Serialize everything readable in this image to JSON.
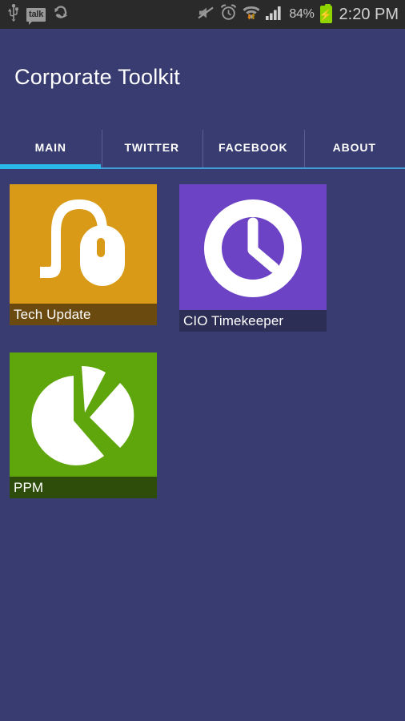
{
  "statusbar": {
    "left_icons": [
      {
        "name": "usb-icon",
        "glyph": "usb"
      },
      {
        "name": "talk-icon",
        "label": "talk"
      },
      {
        "name": "sync-icon",
        "glyph": "sync"
      }
    ],
    "right_icons": [
      {
        "name": "mute-icon",
        "glyph": "speaker-muted"
      },
      {
        "name": "alarm-clock-icon",
        "glyph": "alarm"
      },
      {
        "name": "wifi-data-icon",
        "glyph": "wifi-download"
      },
      {
        "name": "signal-bars-icon",
        "glyph": "signal"
      }
    ],
    "battery_percent": "84%",
    "battery_charging": true,
    "time": "2:20 PM"
  },
  "header": {
    "title": "Corporate Toolkit"
  },
  "tabs": {
    "items": [
      {
        "label": "MAIN",
        "active": true
      },
      {
        "label": "TWITTER",
        "active": false
      },
      {
        "label": "FACEBOOK",
        "active": false
      },
      {
        "label": "ABOUT",
        "active": false
      }
    ],
    "indicator_color": "#2bb8e8",
    "underline_color": "#3f9fd6"
  },
  "colors": {
    "background": "#383c70",
    "statusbar": "#2a2a2a",
    "accent": "#2bb8e8",
    "battery_green": "#8fd400"
  },
  "tiles": [
    {
      "label": "Tech Update",
      "icon": "mouse-icon",
      "tile_color": "#d99a17",
      "label_bar_color": "#6b4a10",
      "label_text_color": "#ffffff"
    },
    {
      "label": "CIO Timekeeper",
      "icon": "clock-icon",
      "tile_color": "#6c43c4",
      "label_bar_color": "#2c2e55",
      "label_text_color": "#ffffff"
    },
    {
      "label": "PPM",
      "icon": "pie-chart-icon",
      "tile_color": "#5fa50c",
      "label_bar_color": "#2e4d0b",
      "label_text_color": "#ffffff"
    }
  ]
}
